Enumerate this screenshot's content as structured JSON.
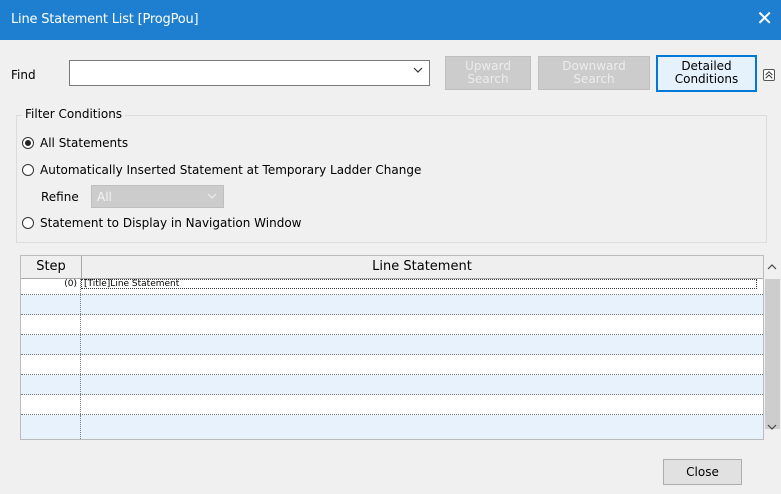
{
  "window": {
    "title": "Line Statement List [ProgPou]"
  },
  "find": {
    "label": "Find",
    "value": "",
    "upward_search": [
      "Upward",
      "Search"
    ],
    "downward_search": [
      "Downward",
      "Search"
    ],
    "detailed_conditions": [
      "Detailed",
      "Conditions"
    ]
  },
  "filter": {
    "title": "Filter Conditions",
    "options": [
      {
        "label": "All Statements",
        "selected": true
      },
      {
        "label": "Automatically Inserted Statement at Temporary Ladder Change",
        "selected": false
      },
      {
        "label": "Statement to Display in Navigation Window",
        "selected": false
      }
    ],
    "refine_label": "Refine",
    "refine_value": "All"
  },
  "table": {
    "columns": [
      "Step",
      "Line Statement"
    ],
    "rows": [
      {
        "step": "(0)",
        "statement": "[Title]Line Statement"
      }
    ]
  },
  "footer": {
    "close_label": "Close"
  }
}
